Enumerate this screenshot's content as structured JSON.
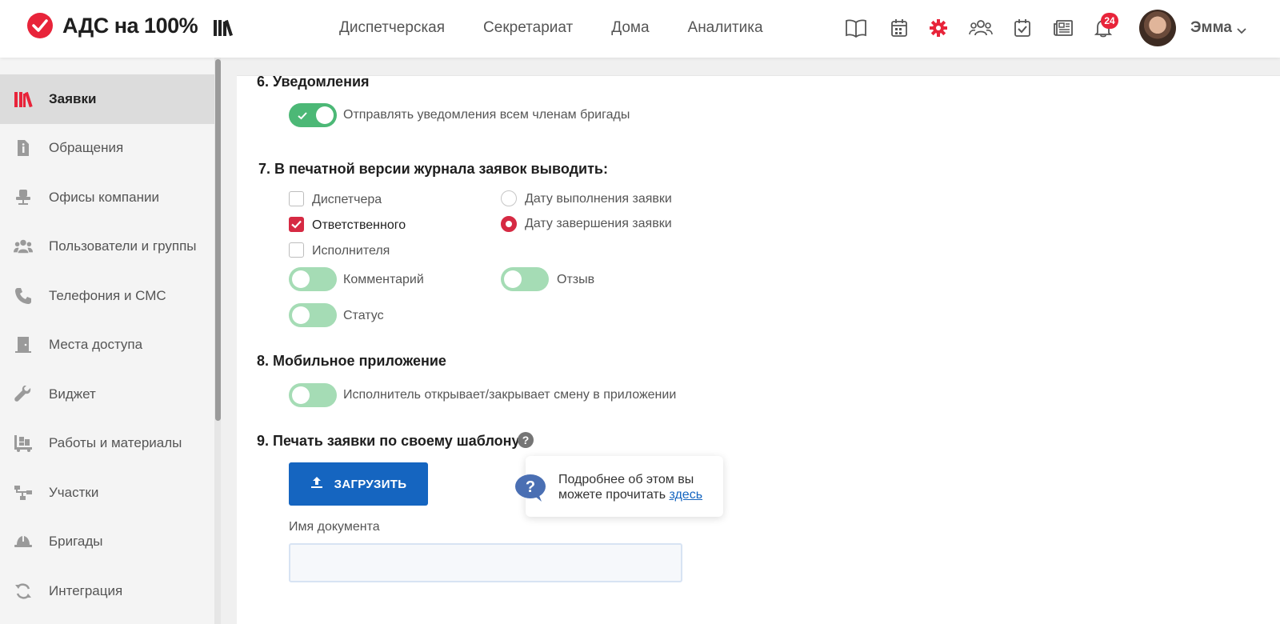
{
  "header": {
    "logo_text": "АДС на 100%",
    "nav": [
      "Диспетчерская",
      "Секретариат",
      "Дома",
      "Аналитика"
    ],
    "icons": [
      "book-icon",
      "calendar-icon",
      "settings-gear-icon",
      "users-icon",
      "checklist-icon",
      "news-icon",
      "bell-icon"
    ],
    "notification_count": "24",
    "user_name": "Эмма",
    "accent_color": "#e8243a"
  },
  "sidebar": {
    "items": [
      {
        "label": "Заявки",
        "icon": "requests-icon",
        "active": true
      },
      {
        "label": "Обращения",
        "icon": "document-info-icon"
      },
      {
        "label": "Офисы компании",
        "icon": "office-chair-icon"
      },
      {
        "label": "Пользователи и группы",
        "icon": "users-group-icon"
      },
      {
        "label": "Телефония и СМС",
        "icon": "phone-icon"
      },
      {
        "label": "Места доступа",
        "icon": "door-icon"
      },
      {
        "label": "Виджет",
        "icon": "wrench-icon"
      },
      {
        "label": "Работы и материалы",
        "icon": "dolly-icon"
      },
      {
        "label": "Участки",
        "icon": "sitemap-icon"
      },
      {
        "label": "Бригады",
        "icon": "hard-hat-icon"
      },
      {
        "label": "Интеграция",
        "icon": "sync-icon"
      }
    ]
  },
  "main": {
    "section6": {
      "title": "6. Уведомления",
      "toggle_label": "Отправлять уведомления всем членам бригады",
      "toggle_on": true
    },
    "section7": {
      "title": "7. В печатной версии журнала заявок выводить:",
      "checkboxes": [
        {
          "label": "Диспетчера",
          "checked": false
        },
        {
          "label": "Ответственного",
          "checked": true
        },
        {
          "label": "Исполнителя",
          "checked": false
        }
      ],
      "radios": [
        {
          "label": "Дату выполнения заявки",
          "checked": false
        },
        {
          "label": "Дату завершения заявки",
          "checked": true
        }
      ],
      "toggles": [
        {
          "label": "Комментарий",
          "on": false
        },
        {
          "label": "Отзыв",
          "on": false
        },
        {
          "label": "Статус",
          "on": false
        }
      ]
    },
    "section8": {
      "title": "8. Мобильное приложение",
      "toggle_label": "Исполнитель открывает/закрывает смену в приложении",
      "toggle_on": false
    },
    "section9": {
      "title": "9. Печать заявки по своему шаблону",
      "help_glyph": "?",
      "upload_label": "ЗАГРУЗИТЬ",
      "tooltip_text": "Подробнее об этом вы можете прочитать",
      "tooltip_link": "здесь",
      "doc_name_label": "Имя документа",
      "doc_name_value": ""
    }
  },
  "colors": {
    "primary_blue": "#1565c0",
    "toggle_on": "#4cb876",
    "toggle_off": "#a5dcb5",
    "check_red": "#d62a43"
  }
}
